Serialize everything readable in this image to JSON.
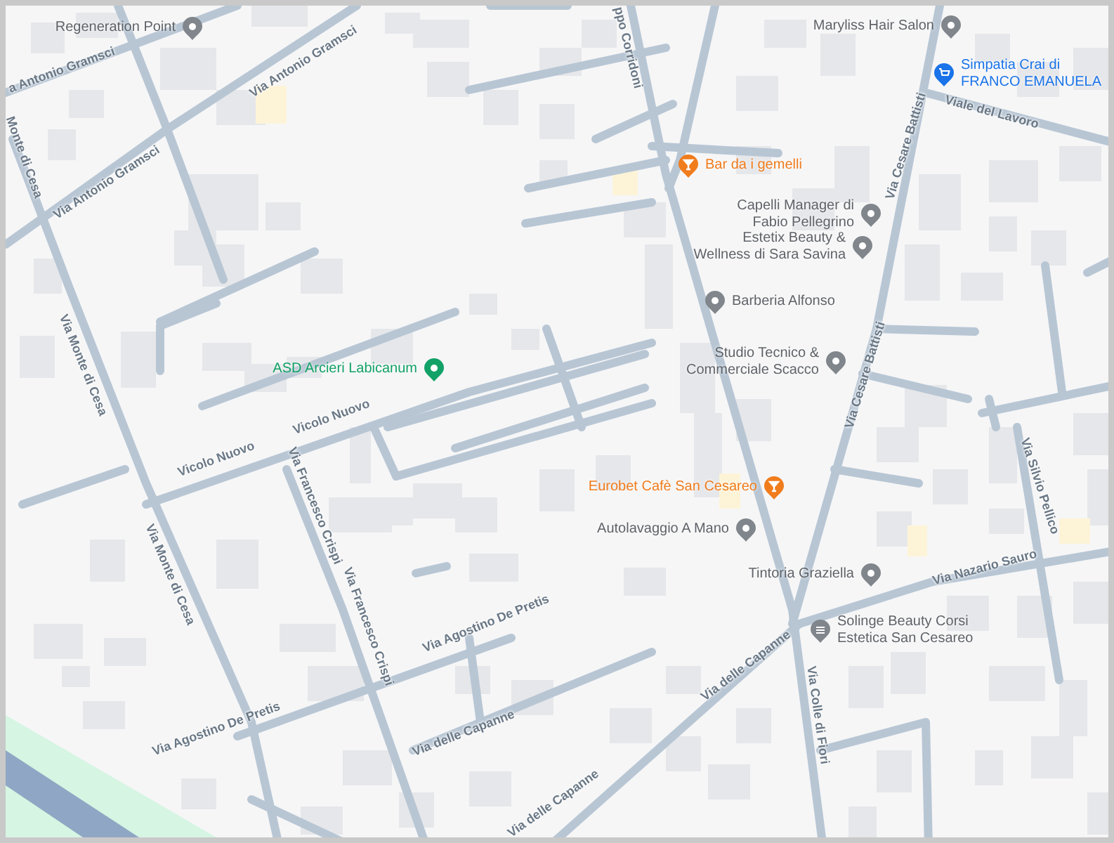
{
  "street_labels": [
    {
      "text": "a Antonio Gramsci"
    },
    {
      "text": "Via Antonio Gramsci"
    },
    {
      "text": "Via Antonio Gramsci"
    },
    {
      "text": "Monte di Cesa"
    },
    {
      "text": "ppo Corridoni"
    },
    {
      "text": "Viale del Lavoro"
    },
    {
      "text": "Via Cesare Battisti"
    },
    {
      "text": "Via Monte di Cesa"
    },
    {
      "text": "Vicolo Nuovo"
    },
    {
      "text": "Vicolo Nuovo"
    },
    {
      "text": "Via Cesare Battisti"
    },
    {
      "text": "Via Francesco Crispi"
    },
    {
      "text": "Via Monte di Cesa"
    },
    {
      "text": "Via Silvio Pellico"
    },
    {
      "text": "Via Nazario Sauro"
    },
    {
      "text": "Via Francesco Crispi"
    },
    {
      "text": "Via Agostino De Pretis"
    },
    {
      "text": "Via Agostino De Pretis"
    },
    {
      "text": "Via delle Capanne"
    },
    {
      "text": "Via delle Capanne"
    },
    {
      "text": "Via Colle di Fiori"
    },
    {
      "text": "Via delle Capanne"
    }
  ],
  "places": [
    {
      "lines": [
        "Regeneration Point"
      ],
      "kind": "place",
      "color": "#80868b"
    },
    {
      "lines": [
        "Maryliss Hair Salon"
      ],
      "kind": "place",
      "color": "#80868b"
    },
    {
      "lines": [
        "Simpatia Crai di",
        "FRANCO EMANUELA"
      ],
      "kind": "shop",
      "color": "#1a73e8"
    },
    {
      "lines": [
        "Bar da i gemelli"
      ],
      "kind": "food",
      "color": "#f07c1c"
    },
    {
      "lines": [
        "Capelli Manager di",
        "Fabio Pellegrino"
      ],
      "kind": "place",
      "color": "#80868b"
    },
    {
      "lines": [
        "Estetix Beauty &",
        "Wellness di Sara Savina"
      ],
      "kind": "place",
      "color": "#80868b"
    },
    {
      "lines": [
        "ASD Arcieri Labicanum"
      ],
      "kind": "sport",
      "color": "#12a166"
    },
    {
      "lines": [
        "Barberia Alfonso"
      ],
      "kind": "place",
      "color": "#80868b"
    },
    {
      "lines": [
        "Studio Tecnico &",
        "Commerciale Scacco"
      ],
      "kind": "place",
      "color": "#80868b"
    },
    {
      "lines": [
        "Eurobet Cafè San Cesareo"
      ],
      "kind": "food",
      "color": "#f07c1c"
    },
    {
      "lines": [
        "Autolavaggio A Mano"
      ],
      "kind": "place",
      "color": "#80868b"
    },
    {
      "lines": [
        "Tintoria Graziella"
      ],
      "kind": "place",
      "color": "#80868b"
    },
    {
      "lines": [
        "Solinge Beauty Corsi",
        "Estetica San Cesareo"
      ],
      "kind": "beauty",
      "color": "#80868b"
    }
  ]
}
